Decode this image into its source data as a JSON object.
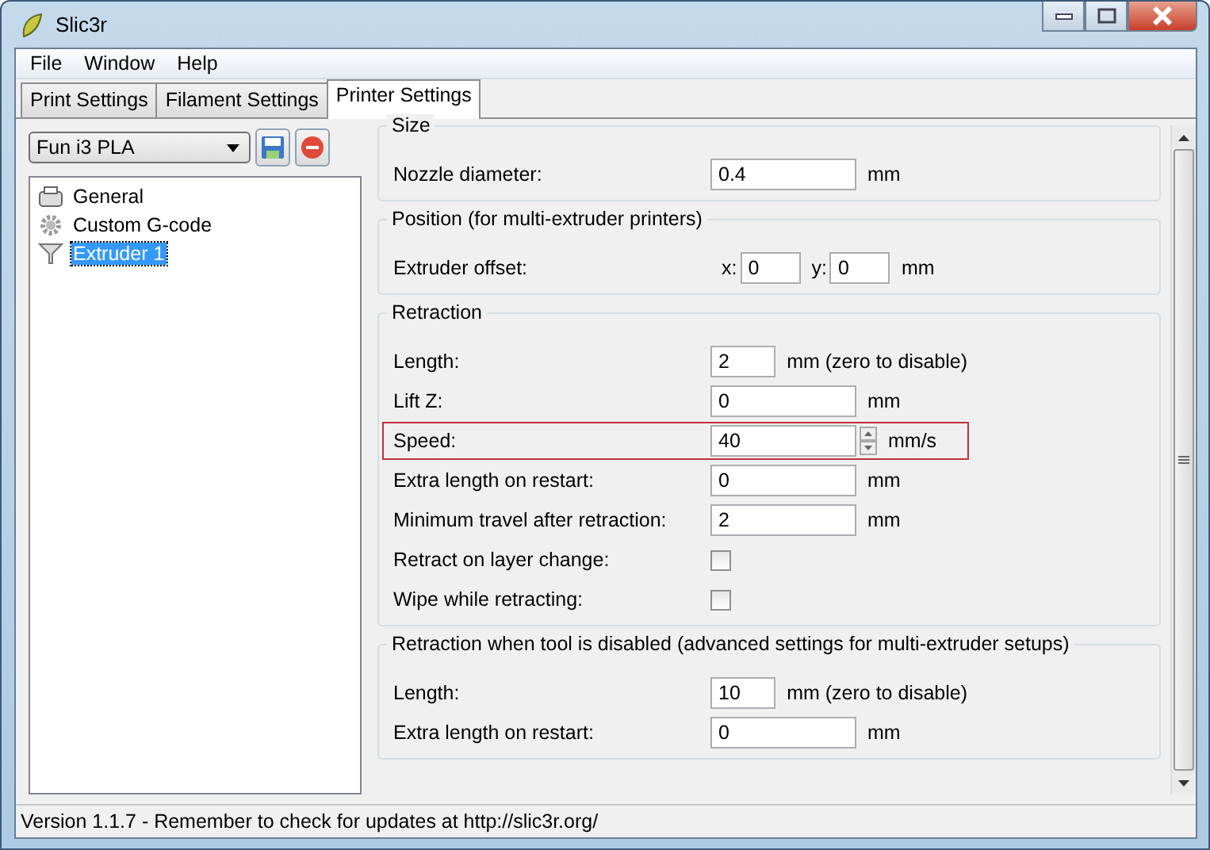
{
  "window": {
    "title": "Slic3r"
  },
  "menu": [
    "File",
    "Window",
    "Help"
  ],
  "tabs": [
    {
      "label": "Print Settings",
      "selected": false
    },
    {
      "label": "Filament Settings",
      "selected": false
    },
    {
      "label": "Printer Settings",
      "selected": true
    }
  ],
  "preset": {
    "value": "Fun i3 PLA"
  },
  "tree": [
    {
      "label": "General",
      "kind": "printer",
      "selected": false
    },
    {
      "label": "Custom G-code",
      "kind": "gear",
      "selected": false
    },
    {
      "label": "Extruder 1",
      "kind": "funnel",
      "selected": true
    }
  ],
  "sections": [
    {
      "title": "Size",
      "rows": [
        {
          "kind": "text",
          "label": "Nozzle diameter:",
          "value": "0.4",
          "unit": "mm",
          "highlighted": false
        }
      ]
    },
    {
      "title": "Position (for multi-extruder printers)",
      "rows": [
        {
          "kind": "xy",
          "label": "Extruder offset:",
          "fields": [
            {
              "prefix": "x:",
              "value": "0"
            },
            {
              "prefix": "y:",
              "value": "0"
            }
          ],
          "unit": "mm",
          "highlighted": false
        }
      ]
    },
    {
      "title": "Retraction",
      "rows": [
        {
          "kind": "text",
          "label": "Length:",
          "value": "2",
          "unit": "mm (zero to disable)",
          "highlighted": false
        },
        {
          "kind": "text",
          "label": "Lift Z:",
          "value": "0",
          "unit": "mm",
          "highlighted": false
        },
        {
          "kind": "spin",
          "label": "Speed:",
          "value": "40",
          "unit": "mm/s",
          "highlighted": true
        },
        {
          "kind": "text",
          "label": "Extra length on restart:",
          "value": "0",
          "unit": "mm",
          "highlighted": false
        },
        {
          "kind": "text",
          "label": "Minimum travel after retraction:",
          "value": "2",
          "unit": "mm",
          "highlighted": false
        },
        {
          "kind": "checkbox",
          "label": "Retract on layer change:",
          "checked": false,
          "highlighted": false
        },
        {
          "kind": "checkbox",
          "label": "Wipe while retracting:",
          "checked": false,
          "highlighted": false
        }
      ]
    },
    {
      "title": "Retraction when tool is disabled (advanced settings for multi-extruder setups)",
      "rows": [
        {
          "kind": "text",
          "label": "Length:",
          "value": "10",
          "unit": "mm (zero to disable)",
          "highlighted": false
        },
        {
          "kind": "text",
          "label": "Extra length on restart:",
          "value": "0",
          "unit": "mm",
          "highlighted": false
        }
      ]
    }
  ],
  "status_bar": "Version 1.1.7 - Remember to check for updates at http://slic3r.org/"
}
